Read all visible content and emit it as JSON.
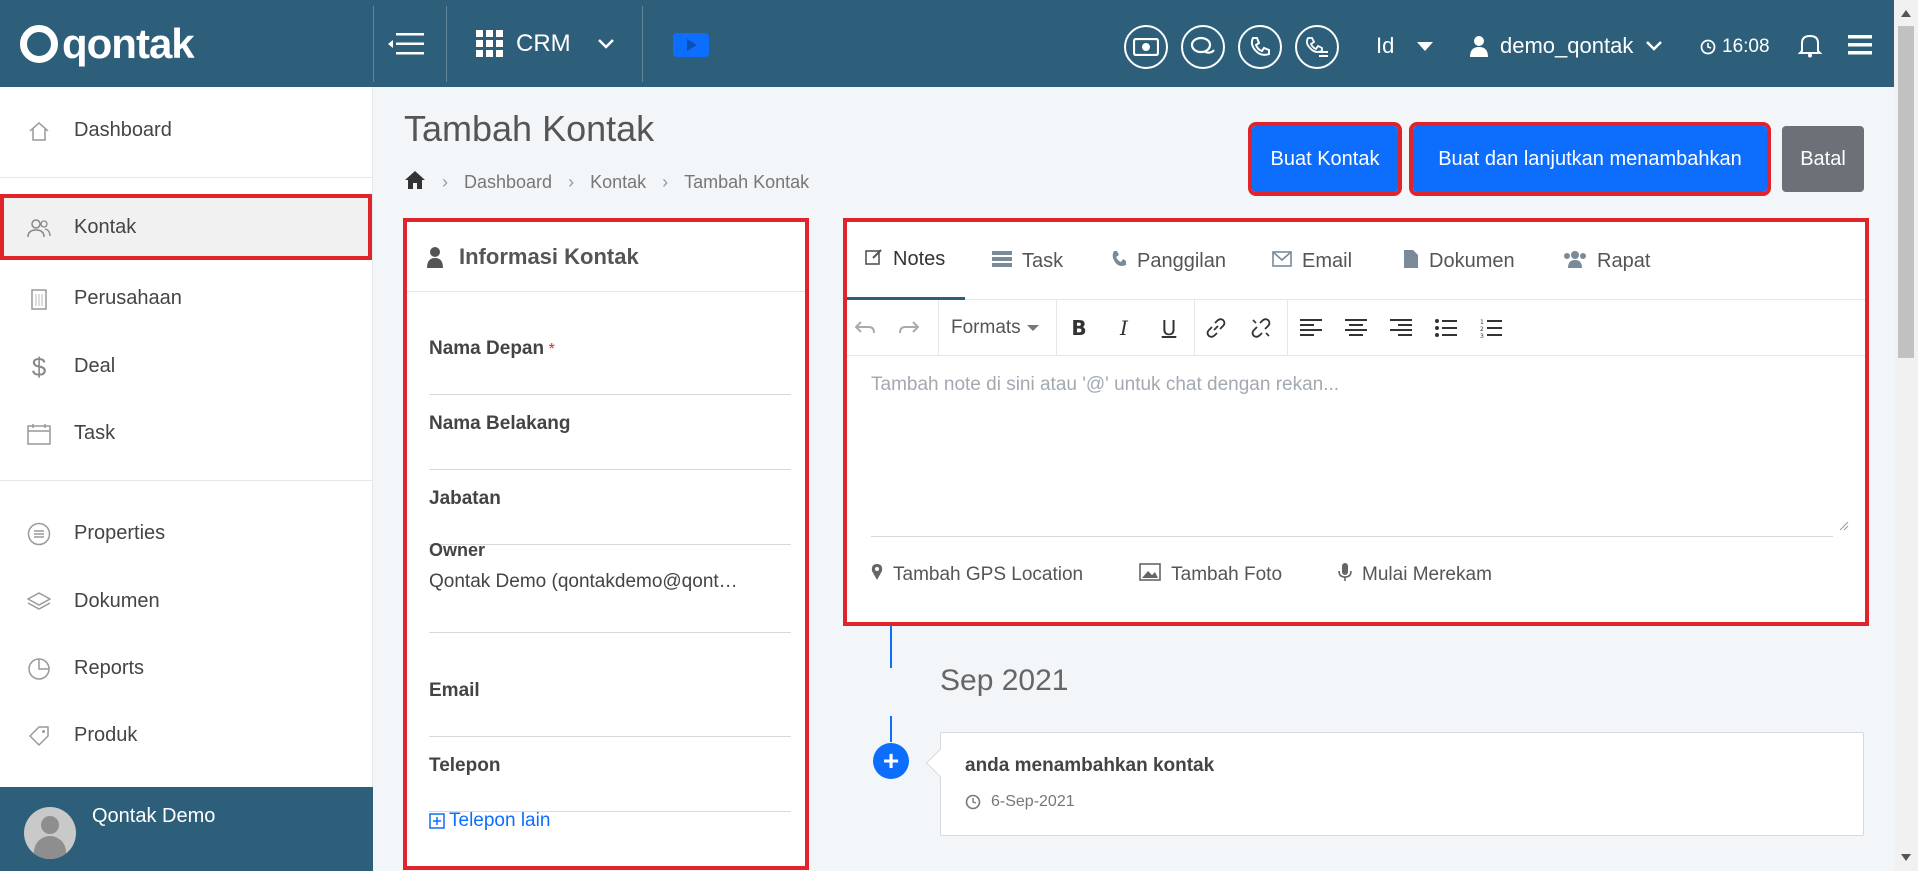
{
  "brand": {
    "logo_text": "qontak"
  },
  "topbar": {
    "module": "CRM",
    "language": "Id",
    "username": "demo_qontak",
    "time": "16:08"
  },
  "sidebar": {
    "items": [
      {
        "label": "Dashboard",
        "icon": "home-icon"
      },
      {
        "label": "Kontak",
        "icon": "users-icon"
      },
      {
        "label": "Perusahaan",
        "icon": "building-icon"
      },
      {
        "label": "Deal",
        "icon": "dollar-icon"
      },
      {
        "label": "Task",
        "icon": "calendar-icon"
      },
      {
        "label": "Properties",
        "icon": "list-icon"
      },
      {
        "label": "Dokumen",
        "icon": "layers-icon"
      },
      {
        "label": "Reports",
        "icon": "pie-chart-icon"
      },
      {
        "label": "Produk",
        "icon": "tag-icon"
      }
    ],
    "user": "Qontak Demo"
  },
  "main": {
    "title": "Tambah Kontak",
    "breadcrumb": [
      "Dashboard",
      "Kontak",
      "Tambah Kontak"
    ],
    "actions": {
      "create": "Buat Kontak",
      "create_continue": "Buat dan lanjutkan menambahkan",
      "cancel": "Batal"
    }
  },
  "contact_form": {
    "header": "Informasi Kontak",
    "fields": {
      "first_name": "Nama Depan",
      "last_name": "Nama Belakang",
      "job_title": "Jabatan",
      "owner_label": "Owner",
      "owner_value": "Qontak Demo (qontakdemo@qont…",
      "email": "Email",
      "phone": "Telepon"
    },
    "add_phone": "Telepon lain",
    "required_marker": "*"
  },
  "activity": {
    "tabs": [
      "Notes",
      "Task",
      "Panggilan",
      "Email",
      "Dokumen",
      "Rapat"
    ],
    "formats_label": "Formats",
    "note_placeholder": "Tambah note di sini atau '@' untuk chat dengan rekan...",
    "footer": {
      "gps": "Tambah GPS Location",
      "photo": "Tambah Foto",
      "record": "Mulai Merekam"
    }
  },
  "timeline": {
    "month": "Sep 2021",
    "entry_title": "anda menambahkan kontak",
    "entry_date": "6-Sep-2021"
  },
  "colors": {
    "header_bg": "#2e5f7a",
    "primary": "#0d6efd",
    "highlight_border": "#e0242c",
    "cancel_bg": "#6b7177"
  }
}
